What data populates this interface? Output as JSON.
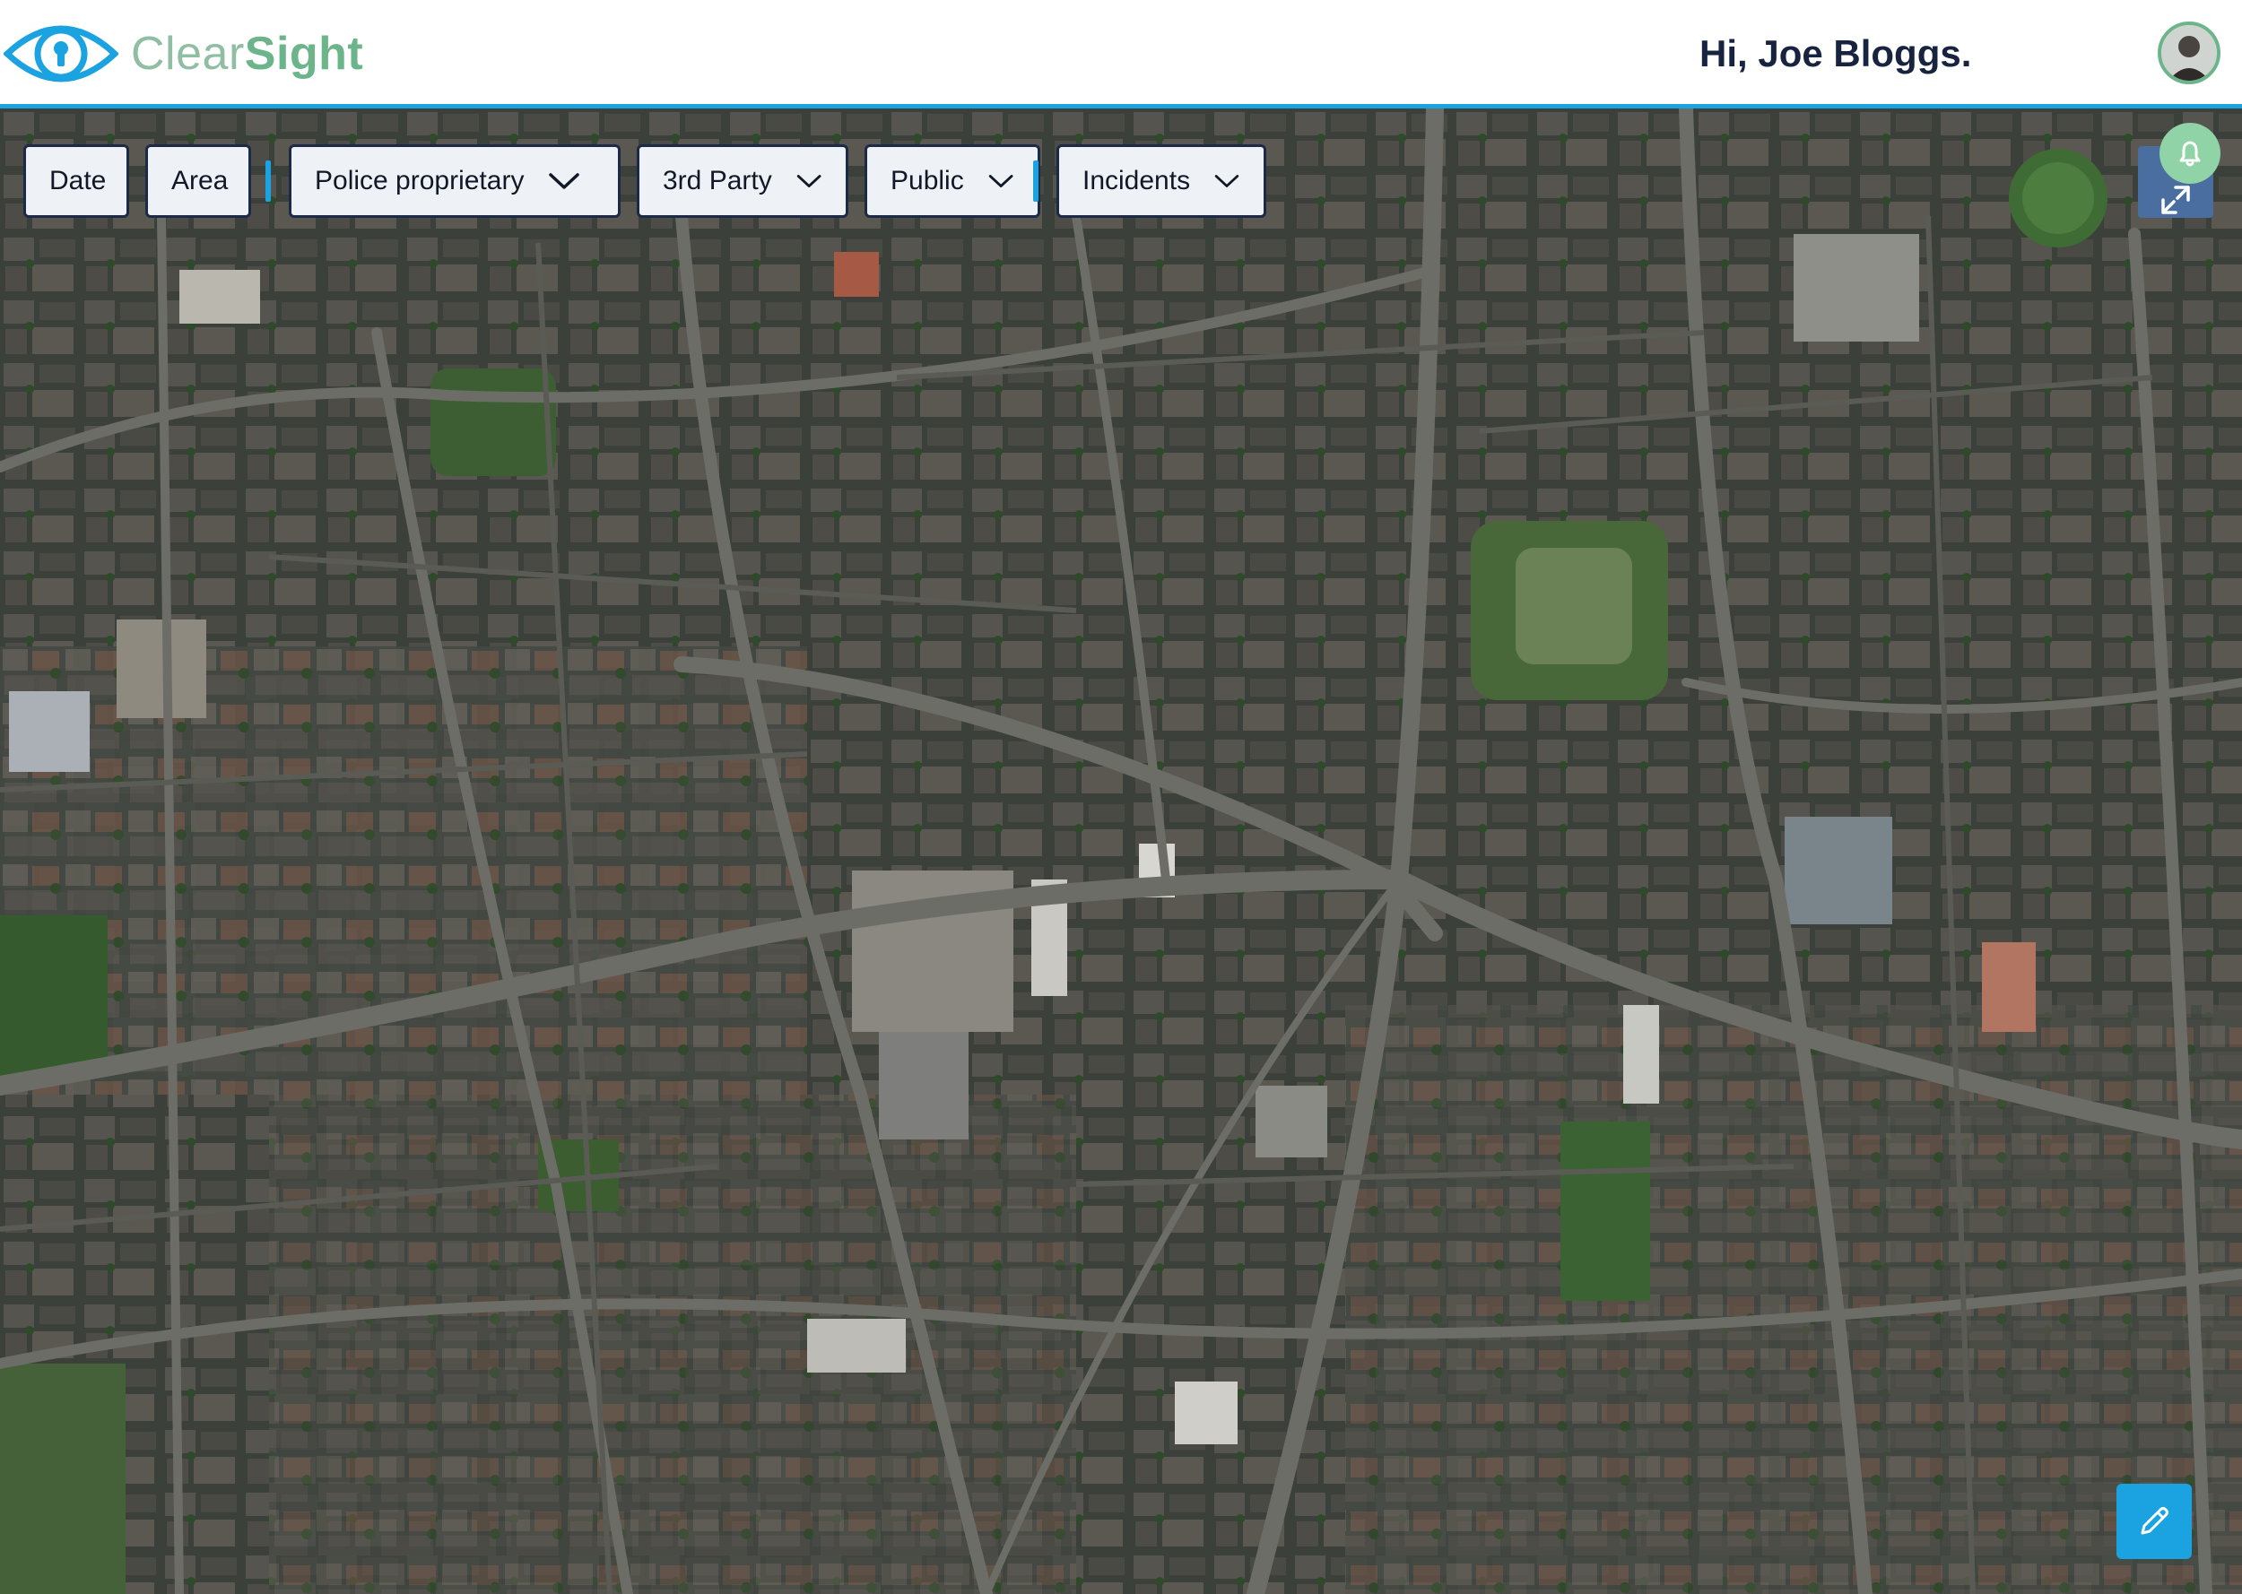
{
  "app": {
    "logo_part1": "Clear",
    "logo_part2": "Sight",
    "greeting": "Hi, Joe Bloggs."
  },
  "filters": [
    {
      "label": "Date",
      "has_dropdown": false
    },
    {
      "label": "Area",
      "has_dropdown": false
    },
    {
      "label": "Police proprietary",
      "has_dropdown": true
    },
    {
      "label": "3rd Party",
      "has_dropdown": true
    },
    {
      "label": "Public",
      "has_dropdown": true
    },
    {
      "label": "Incidents",
      "has_dropdown": true
    }
  ],
  "icons": {
    "logo": "eye-lock-icon",
    "avatar": "user-avatar",
    "notifications": "bell-icon",
    "fullscreen": "expand-icon",
    "edit": "pencil-icon",
    "dropdown": "chevron-down-icon"
  },
  "colors": {
    "accent": "#1aa3e0",
    "brand_green": "#6cb58a",
    "chip_border": "#1c2a48",
    "chip_bg": "#eef1f6",
    "greeting_text": "#18233f",
    "fullscreen_bg": "#4a6ea0",
    "bell_bg": "#8fd3a6"
  }
}
